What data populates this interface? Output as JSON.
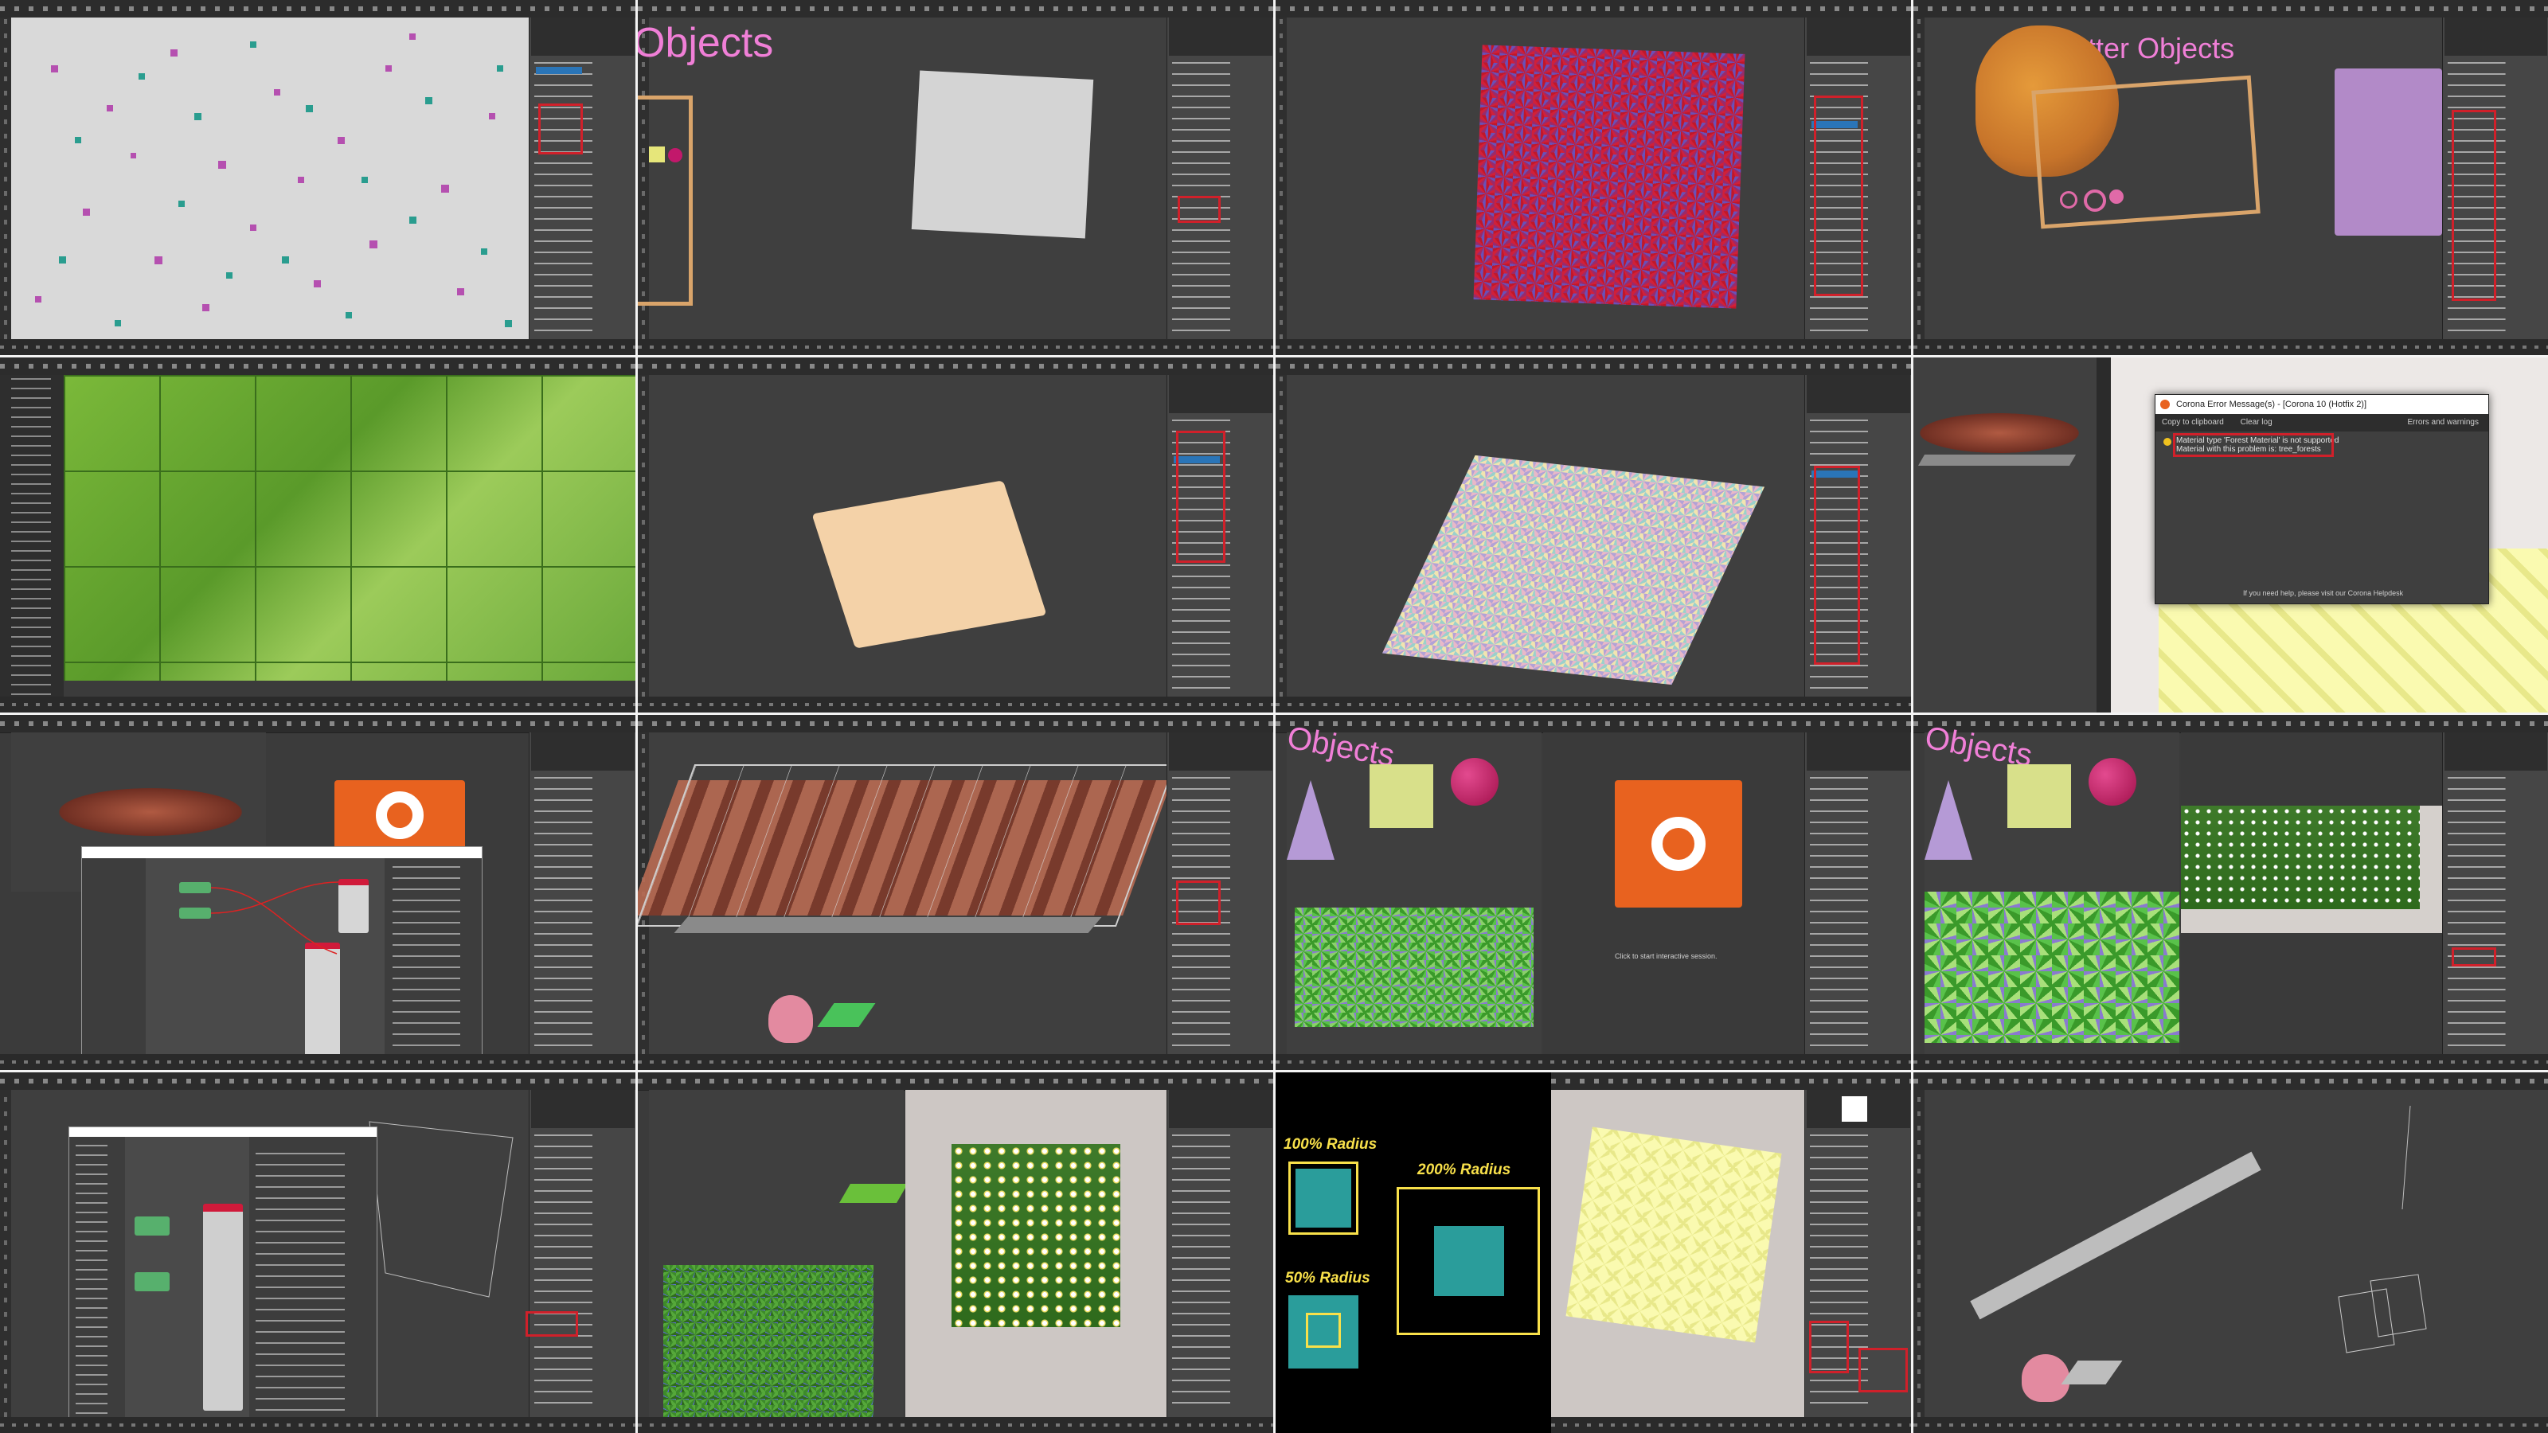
{
  "tiles": {
    "t2": {
      "heading": "Objects"
    },
    "t4": {
      "heading": "atter Objects"
    },
    "t8": {
      "dialog": {
        "title": "Corona Error Message(s) - [Corona 10 (Hotfix 2)]",
        "copy_label": "Copy to clipboard",
        "clear_label": "Clear log",
        "filter_label": "Errors and warnings",
        "message_1": "Material type 'Forest Material' is not supported",
        "message_2": "Material with this problem is: tree_forests",
        "footer": "If you need help, please visit our Corona Helpdesk"
      }
    },
    "t11": {
      "heading": "Objects",
      "hint": "Click to start interactive session."
    },
    "t12": {
      "heading": "Objects"
    },
    "t15": {
      "radius_100": "100% Radius",
      "radius_200": "200% Radius",
      "radius_50": "50% Radius"
    }
  },
  "colors": {
    "ui_dark": "#3b3b3b",
    "panel": "#464646",
    "highlight_red": "#d0202a",
    "corona_orange": "#e8621f",
    "radius_teal": "#2a9d9b",
    "radius_yellow": "#f8e04a",
    "heading_pink": "#f07fd7"
  }
}
